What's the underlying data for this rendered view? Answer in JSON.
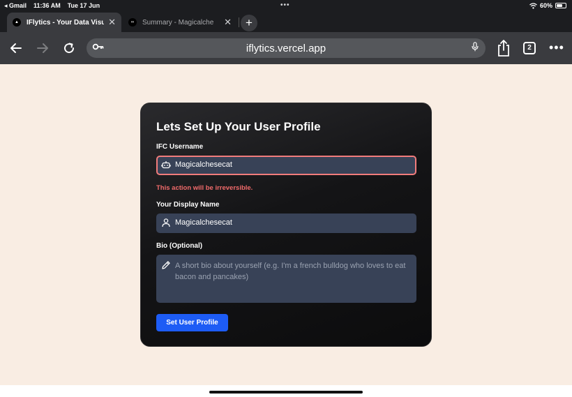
{
  "status_bar": {
    "back_app": "◂ Gmail",
    "time": "11:36 AM",
    "date": "Tue 17 Jun",
    "battery": "60%"
  },
  "tabs": [
    {
      "title": "IFlytics - Your Data Visu",
      "active": true,
      "close": "✕"
    },
    {
      "title": "Summary - Magicalche",
      "active": false,
      "close": "✕"
    }
  ],
  "toolbar": {
    "url": "iflytics.vercel.app",
    "tab_count": "2",
    "icons": [
      "back-arrow",
      "forward-arrow",
      "reload",
      "key",
      "microphone",
      "share",
      "tabs",
      "more"
    ]
  },
  "form": {
    "title": "Lets Set Up Your User Profile",
    "username_label": "IFC Username",
    "username_value": "Magicalchesecat",
    "warning": "This action will be irreversible.",
    "display_label": "Your Display Name",
    "display_value": "Magicalchesecat",
    "bio_label": "Bio (Optional)",
    "bio_placeholder": "A short bio about yourself (e.g. I'm a french bulldog who loves to eat bacon and pancakes)",
    "submit_label": "Set User Profile"
  },
  "colors": {
    "page_background": "#f9ede3",
    "card_background": "#141416",
    "input_background": "#384257",
    "error": "#f26b6b",
    "primary_button": "#1d5cf5"
  }
}
